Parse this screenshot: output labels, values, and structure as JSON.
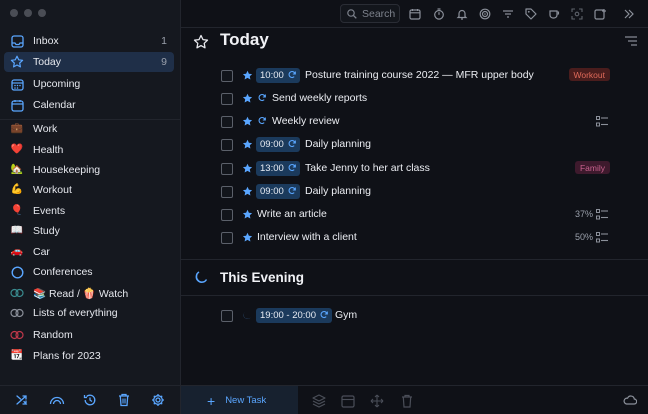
{
  "sidebar": {
    "items": [
      {
        "label": "Inbox",
        "count": "1",
        "icon": "inbox-icon"
      },
      {
        "label": "Today",
        "count": "9",
        "icon": "star-icon"
      },
      {
        "label": "Upcoming",
        "count": "",
        "icon": "calendar-grid-icon"
      },
      {
        "label": "Calendar",
        "count": "",
        "icon": "calendar-icon"
      },
      {
        "label": "Work",
        "count": "",
        "icon": "briefcase-emoji"
      },
      {
        "label": "Health",
        "count": "",
        "icon": "heart-emoji"
      },
      {
        "label": "Housekeeping",
        "count": "",
        "icon": "house-emoji"
      },
      {
        "label": "Workout",
        "count": "",
        "icon": "flexed-biceps-emoji"
      },
      {
        "label": "Events",
        "count": "",
        "icon": "balloon-emoji"
      },
      {
        "label": "Study",
        "count": "",
        "icon": "book-emoji"
      },
      {
        "label": "Car",
        "count": "",
        "icon": "car-emoji"
      },
      {
        "label": "Conferences",
        "count": "",
        "icon": "ring-icon"
      },
      {
        "label": "📚 Read / 🍿 Watch",
        "count": "",
        "icon": "double-ring-icon"
      },
      {
        "label": "Lists of everything",
        "count": "",
        "icon": "double-ring-icon"
      },
      {
        "label": "Random",
        "count": "",
        "icon": "red-double-ring-icon"
      },
      {
        "label": "Plans for 2023",
        "count": "",
        "icon": "calendar-emoji"
      }
    ],
    "bottom_icons": [
      "shuffle-icon",
      "rainbow-icon",
      "history-icon",
      "trash-icon",
      "gear-icon"
    ]
  },
  "topbar": {
    "search_placeholder": "Search",
    "icons": [
      "calendar-icon",
      "timer-icon",
      "bell-icon",
      "focus-icon",
      "filter-icon",
      "tag-icon",
      "cup-icon",
      "capture-icon",
      "add-window-icon",
      "expand-icon"
    ]
  },
  "today": {
    "title": "Today",
    "tasks": [
      {
        "time": "10:00",
        "label": "Posture training course 2022 — MFR upper body",
        "tag": "Workout",
        "tag_type": "work",
        "percent": "",
        "subtasks": false
      },
      {
        "time": "",
        "label": "Send weekly reports",
        "tag": "",
        "tag_type": "",
        "percent": "",
        "subtasks": false
      },
      {
        "time": "",
        "label": "Weekly review",
        "tag": "",
        "tag_type": "",
        "percent": "",
        "subtasks": true
      },
      {
        "time": "09:00",
        "label": "Daily planning",
        "tag": "",
        "tag_type": "",
        "percent": "",
        "subtasks": false
      },
      {
        "time": "13:00",
        "label": "Take Jenny to her art class",
        "tag": "Family",
        "tag_type": "family",
        "percent": "",
        "subtasks": false
      },
      {
        "time": "09:00",
        "label": "Daily planning",
        "tag": "",
        "tag_type": "",
        "percent": "",
        "subtasks": false
      },
      {
        "time": "",
        "label": "Write an article",
        "tag": "",
        "tag_type": "",
        "percent": "37%",
        "subtasks": true
      },
      {
        "time": "",
        "label": "Interview with a client",
        "tag": "",
        "tag_type": "",
        "percent": "50%",
        "subtasks": true
      }
    ]
  },
  "evening": {
    "title": "This Evening",
    "tasks": [
      {
        "time": "19:00 - 20:00",
        "label": "Gym"
      }
    ]
  },
  "bottombar": {
    "new_task_label": "New Task",
    "icons": [
      "layers-icon",
      "calendar-icon",
      "move-icon",
      "trash-icon",
      "cloud-icon"
    ]
  },
  "colors": {
    "accent": "#5aa6ff",
    "background": "#0f1117",
    "sidebar": "#15181f",
    "time_chip": "#1b3a5c"
  }
}
